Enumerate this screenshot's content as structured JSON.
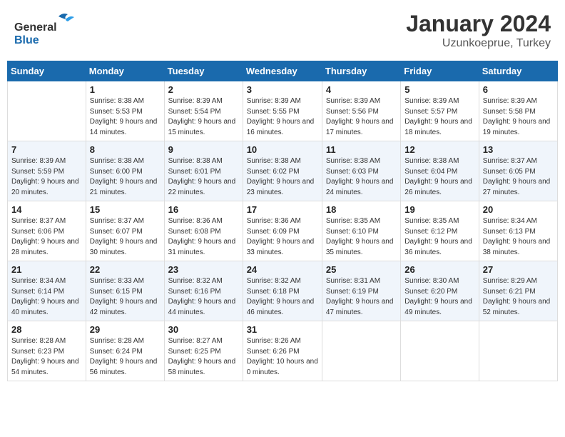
{
  "header": {
    "logo_general": "General",
    "logo_blue": "Blue",
    "month_year": "January 2024",
    "location": "Uzunkoeprue, Turkey"
  },
  "days_of_week": [
    "Sunday",
    "Monday",
    "Tuesday",
    "Wednesday",
    "Thursday",
    "Friday",
    "Saturday"
  ],
  "weeks": [
    [
      {
        "day": "",
        "sunrise": "",
        "sunset": "",
        "daylight": ""
      },
      {
        "day": "1",
        "sunrise": "Sunrise: 8:38 AM",
        "sunset": "Sunset: 5:53 PM",
        "daylight": "Daylight: 9 hours and 14 minutes."
      },
      {
        "day": "2",
        "sunrise": "Sunrise: 8:39 AM",
        "sunset": "Sunset: 5:54 PM",
        "daylight": "Daylight: 9 hours and 15 minutes."
      },
      {
        "day": "3",
        "sunrise": "Sunrise: 8:39 AM",
        "sunset": "Sunset: 5:55 PM",
        "daylight": "Daylight: 9 hours and 16 minutes."
      },
      {
        "day": "4",
        "sunrise": "Sunrise: 8:39 AM",
        "sunset": "Sunset: 5:56 PM",
        "daylight": "Daylight: 9 hours and 17 minutes."
      },
      {
        "day": "5",
        "sunrise": "Sunrise: 8:39 AM",
        "sunset": "Sunset: 5:57 PM",
        "daylight": "Daylight: 9 hours and 18 minutes."
      },
      {
        "day": "6",
        "sunrise": "Sunrise: 8:39 AM",
        "sunset": "Sunset: 5:58 PM",
        "daylight": "Daylight: 9 hours and 19 minutes."
      }
    ],
    [
      {
        "day": "7",
        "sunrise": "Sunrise: 8:39 AM",
        "sunset": "Sunset: 5:59 PM",
        "daylight": "Daylight: 9 hours and 20 minutes."
      },
      {
        "day": "8",
        "sunrise": "Sunrise: 8:38 AM",
        "sunset": "Sunset: 6:00 PM",
        "daylight": "Daylight: 9 hours and 21 minutes."
      },
      {
        "day": "9",
        "sunrise": "Sunrise: 8:38 AM",
        "sunset": "Sunset: 6:01 PM",
        "daylight": "Daylight: 9 hours and 22 minutes."
      },
      {
        "day": "10",
        "sunrise": "Sunrise: 8:38 AM",
        "sunset": "Sunset: 6:02 PM",
        "daylight": "Daylight: 9 hours and 23 minutes."
      },
      {
        "day": "11",
        "sunrise": "Sunrise: 8:38 AM",
        "sunset": "Sunset: 6:03 PM",
        "daylight": "Daylight: 9 hours and 24 minutes."
      },
      {
        "day": "12",
        "sunrise": "Sunrise: 8:38 AM",
        "sunset": "Sunset: 6:04 PM",
        "daylight": "Daylight: 9 hours and 26 minutes."
      },
      {
        "day": "13",
        "sunrise": "Sunrise: 8:37 AM",
        "sunset": "Sunset: 6:05 PM",
        "daylight": "Daylight: 9 hours and 27 minutes."
      }
    ],
    [
      {
        "day": "14",
        "sunrise": "Sunrise: 8:37 AM",
        "sunset": "Sunset: 6:06 PM",
        "daylight": "Daylight: 9 hours and 28 minutes."
      },
      {
        "day": "15",
        "sunrise": "Sunrise: 8:37 AM",
        "sunset": "Sunset: 6:07 PM",
        "daylight": "Daylight: 9 hours and 30 minutes."
      },
      {
        "day": "16",
        "sunrise": "Sunrise: 8:36 AM",
        "sunset": "Sunset: 6:08 PM",
        "daylight": "Daylight: 9 hours and 31 minutes."
      },
      {
        "day": "17",
        "sunrise": "Sunrise: 8:36 AM",
        "sunset": "Sunset: 6:09 PM",
        "daylight": "Daylight: 9 hours and 33 minutes."
      },
      {
        "day": "18",
        "sunrise": "Sunrise: 8:35 AM",
        "sunset": "Sunset: 6:10 PM",
        "daylight": "Daylight: 9 hours and 35 minutes."
      },
      {
        "day": "19",
        "sunrise": "Sunrise: 8:35 AM",
        "sunset": "Sunset: 6:12 PM",
        "daylight": "Daylight: 9 hours and 36 minutes."
      },
      {
        "day": "20",
        "sunrise": "Sunrise: 8:34 AM",
        "sunset": "Sunset: 6:13 PM",
        "daylight": "Daylight: 9 hours and 38 minutes."
      }
    ],
    [
      {
        "day": "21",
        "sunrise": "Sunrise: 8:34 AM",
        "sunset": "Sunset: 6:14 PM",
        "daylight": "Daylight: 9 hours and 40 minutes."
      },
      {
        "day": "22",
        "sunrise": "Sunrise: 8:33 AM",
        "sunset": "Sunset: 6:15 PM",
        "daylight": "Daylight: 9 hours and 42 minutes."
      },
      {
        "day": "23",
        "sunrise": "Sunrise: 8:32 AM",
        "sunset": "Sunset: 6:16 PM",
        "daylight": "Daylight: 9 hours and 44 minutes."
      },
      {
        "day": "24",
        "sunrise": "Sunrise: 8:32 AM",
        "sunset": "Sunset: 6:18 PM",
        "daylight": "Daylight: 9 hours and 46 minutes."
      },
      {
        "day": "25",
        "sunrise": "Sunrise: 8:31 AM",
        "sunset": "Sunset: 6:19 PM",
        "daylight": "Daylight: 9 hours and 47 minutes."
      },
      {
        "day": "26",
        "sunrise": "Sunrise: 8:30 AM",
        "sunset": "Sunset: 6:20 PM",
        "daylight": "Daylight: 9 hours and 49 minutes."
      },
      {
        "day": "27",
        "sunrise": "Sunrise: 8:29 AM",
        "sunset": "Sunset: 6:21 PM",
        "daylight": "Daylight: 9 hours and 52 minutes."
      }
    ],
    [
      {
        "day": "28",
        "sunrise": "Sunrise: 8:28 AM",
        "sunset": "Sunset: 6:23 PM",
        "daylight": "Daylight: 9 hours and 54 minutes."
      },
      {
        "day": "29",
        "sunrise": "Sunrise: 8:28 AM",
        "sunset": "Sunset: 6:24 PM",
        "daylight": "Daylight: 9 hours and 56 minutes."
      },
      {
        "day": "30",
        "sunrise": "Sunrise: 8:27 AM",
        "sunset": "Sunset: 6:25 PM",
        "daylight": "Daylight: 9 hours and 58 minutes."
      },
      {
        "day": "31",
        "sunrise": "Sunrise: 8:26 AM",
        "sunset": "Sunset: 6:26 PM",
        "daylight": "Daylight: 10 hours and 0 minutes."
      },
      {
        "day": "",
        "sunrise": "",
        "sunset": "",
        "daylight": ""
      },
      {
        "day": "",
        "sunrise": "",
        "sunset": "",
        "daylight": ""
      },
      {
        "day": "",
        "sunrise": "",
        "sunset": "",
        "daylight": ""
      }
    ]
  ]
}
